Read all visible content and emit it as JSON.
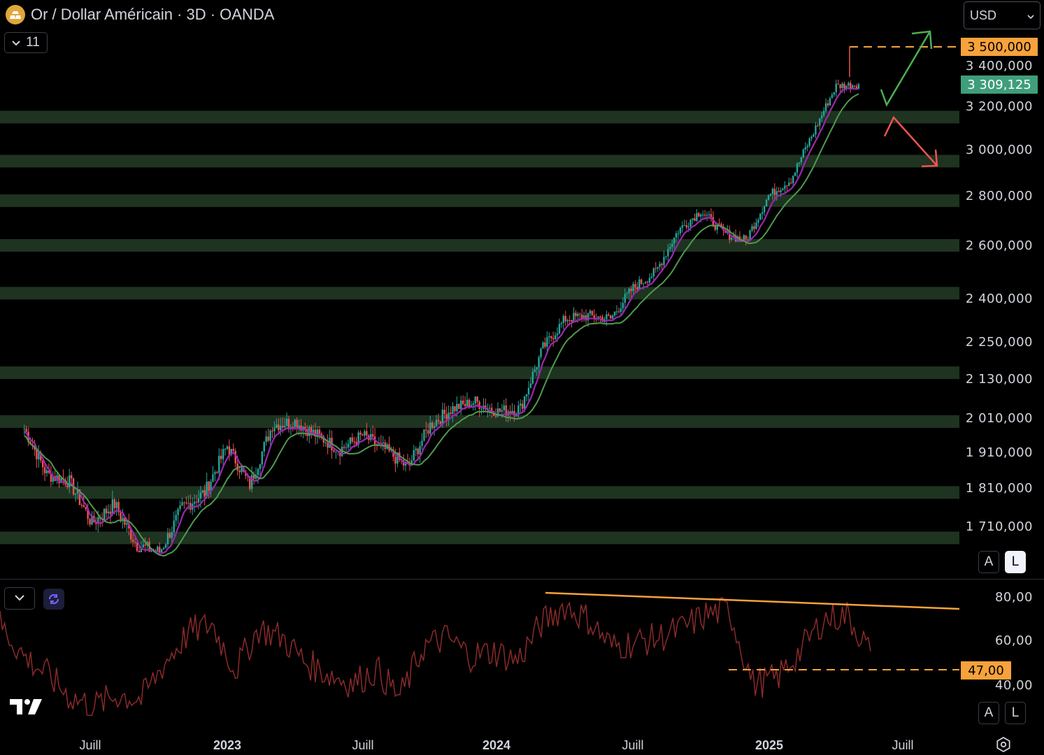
{
  "header": {
    "title": "Or / Dollar Américain · 3D · OANDA",
    "indicator_count": "11",
    "currency": "USD"
  },
  "price_axis": {
    "labels": [
      "3 400,000",
      "3 200,000",
      "3 000,000",
      "2 800,000",
      "2 600,000",
      "2 400,000",
      "2 250,000",
      "2 130,000",
      "2 010,000",
      "1 910,000",
      "1 810,000",
      "1 710,000"
    ],
    "target_tag": "3 500,000",
    "current_tag": "3 309,125",
    "target_color": "#f7a23b",
    "current_color": "#3f9e7c"
  },
  "scale_buttons_main": {
    "auto": "A",
    "log": "L"
  },
  "oscillator_axis": {
    "labels": [
      "80,00",
      "60,00",
      "40,00"
    ],
    "level_tag": "47,00"
  },
  "scale_buttons_osc": {
    "auto": "A",
    "log": "L"
  },
  "time_axis": {
    "labels": [
      {
        "text": "Juill",
        "bold": false
      },
      {
        "text": "2023",
        "bold": true
      },
      {
        "text": "Juill",
        "bold": false
      },
      {
        "text": "2024",
        "bold": true
      },
      {
        "text": "Juill",
        "bold": false
      },
      {
        "text": "2025",
        "bold": true
      },
      {
        "text": "Juill",
        "bold": false
      }
    ]
  },
  "chart_data": [
    {
      "type": "candlestick",
      "title": "Or / Dollar Américain · 3D · OANDA",
      "x_range": [
        "2022-04",
        "2025-09"
      ],
      "ylim": [
        1650,
        3550
      ],
      "support_resistance_zones": [
        3150,
        2950,
        2780,
        2600,
        2420,
        2150,
        2000,
        1800,
        1680
      ],
      "price_path": [
        [
          "2022-04",
          1980
        ],
        [
          "2022-05",
          1850
        ],
        [
          "2022-06",
          1830
        ],
        [
          "2022-07",
          1720
        ],
        [
          "2022-08",
          1770
        ],
        [
          "2022-09",
          1660
        ],
        [
          "2022-10",
          1640
        ],
        [
          "2022-11",
          1760
        ],
        [
          "2022-12",
          1800
        ],
        [
          "2023-01",
          1930
        ],
        [
          "2023-02",
          1820
        ],
        [
          "2023-03",
          1990
        ],
        [
          "2023-04",
          2000
        ],
        [
          "2023-05",
          1960
        ],
        [
          "2023-06",
          1920
        ],
        [
          "2023-07",
          1960
        ],
        [
          "2023-08",
          1920
        ],
        [
          "2023-09",
          1870
        ],
        [
          "2023-10",
          1990
        ],
        [
          "2023-11",
          2040
        ],
        [
          "2023-12",
          2060
        ],
        [
          "2024-01",
          2030
        ],
        [
          "2024-02",
          2040
        ],
        [
          "2024-03",
          2230
        ],
        [
          "2024-04",
          2330
        ],
        [
          "2024-05",
          2340
        ],
        [
          "2024-06",
          2330
        ],
        [
          "2024-07",
          2440
        ],
        [
          "2024-08",
          2500
        ],
        [
          "2024-09",
          2660
        ],
        [
          "2024-10",
          2740
        ],
        [
          "2024-11",
          2650
        ],
        [
          "2024-12",
          2620
        ],
        [
          "2025-01",
          2800
        ],
        [
          "2025-02",
          2870
        ],
        [
          "2025-03",
          3080
        ],
        [
          "2025-04",
          3300
        ],
        [
          "2025-05",
          3309
        ]
      ],
      "last_price": 3309.125,
      "target": 3500,
      "scenarios": [
        "up",
        "down"
      ],
      "moving_average_colors": [
        "#9c27b0",
        "#4caf50"
      ],
      "candle_colors": {
        "up": "#26a69a",
        "down": "#ef5350"
      }
    },
    {
      "type": "line",
      "ylim": [
        30,
        85
      ],
      "series": [
        {
          "values": [
            72,
            58,
            50,
            40,
            36,
            41,
            39,
            55,
            68,
            72,
            52,
            70,
            66,
            55,
            50,
            46,
            52,
            40,
            62,
            66,
            58,
            60,
            56,
            72,
            80,
            74,
            62,
            64,
            66,
            70,
            76,
            78,
            46,
            48,
            60,
            74,
            76,
            60
          ],
          "color": "#8a2a2a"
        }
      ],
      "divergence_line": [
        80,
        74
      ],
      "level": 47
    }
  ]
}
